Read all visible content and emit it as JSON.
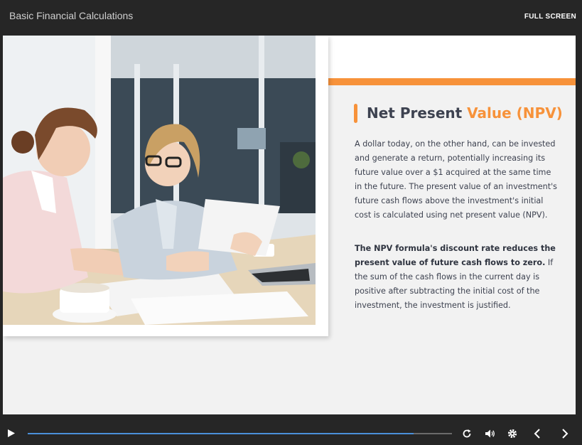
{
  "header": {
    "course_title": "Basic Financial Calculations",
    "fullscreen_label": "FULL SCREEN"
  },
  "slide": {
    "heading_part1": "Net Present ",
    "heading_part2": "Value (NPV)",
    "paragraph1": "A dollar today, on the other hand, can be invested and generate a return, potentially increasing its future value over a $1 acquired at the same time in the future. The present value of an investment's future cash flows above the investment's initial cost is calculated using net present value (NPV).",
    "paragraph2_bold": "The NPV formula's discount rate reduces the present value of future cash flows to zero.",
    "paragraph2_rest": " If the sum of the cash flows in the current day is positive after subtracting the initial cost of the investment, the investment is justified.",
    "image_name": "photo-two-women-reviewing-documents"
  },
  "player": {
    "progress_fraction": 0.91,
    "icons": [
      "play-icon",
      "replay-icon",
      "volume-icon",
      "settings-icon",
      "prev-icon",
      "next-icon"
    ]
  },
  "colors": {
    "accent": "#f7923a",
    "text": "#3d4250",
    "progress": "#4a90d9",
    "chrome": "#262626"
  }
}
